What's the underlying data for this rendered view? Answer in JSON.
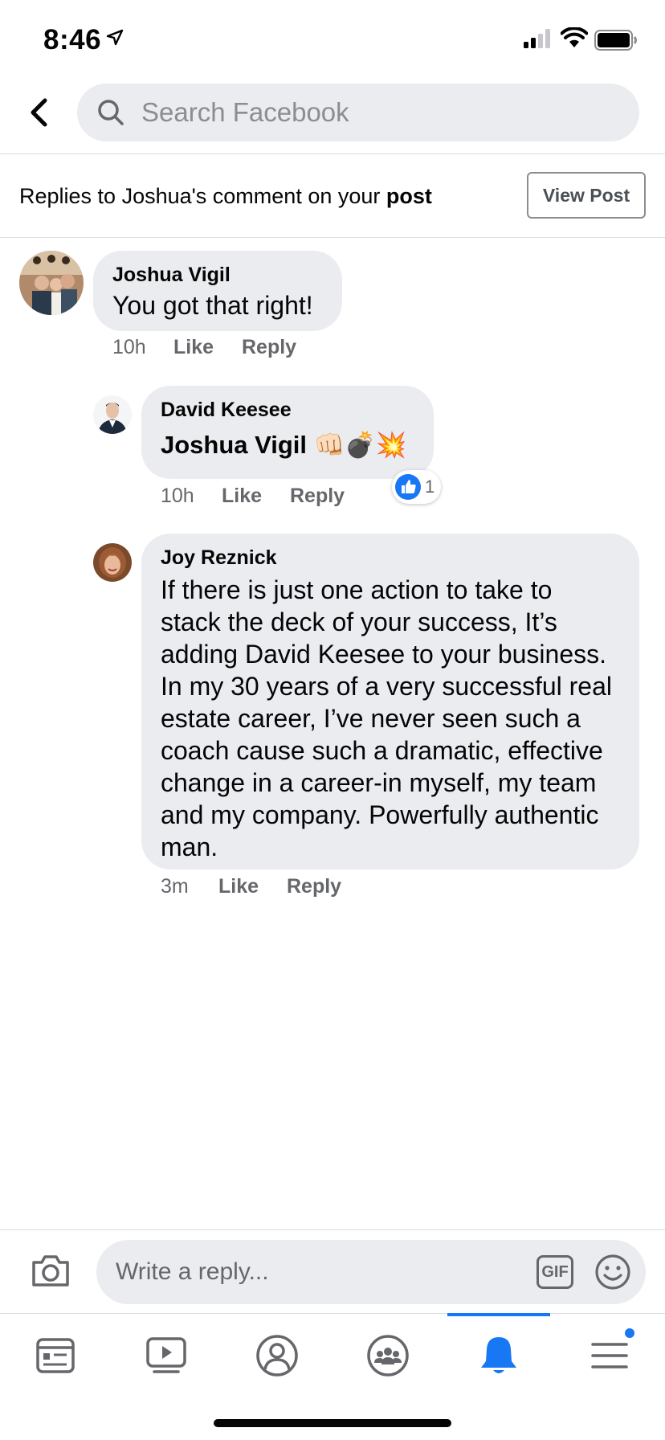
{
  "status_bar": {
    "time": "8:46"
  },
  "header": {
    "search_placeholder": "Search Facebook"
  },
  "banner": {
    "text_prefix": "Replies to Joshua's comment on your ",
    "text_bold": "post",
    "view_post_label": "View Post"
  },
  "comments": [
    {
      "author": "Joshua Vigil",
      "text": "You got that right!",
      "time": "10h",
      "like": "Like",
      "reply": "Reply"
    },
    {
      "author": "David Keesee",
      "text": "Joshua Vigil 👊🏻💣💥",
      "time": "10h",
      "like": "Like",
      "reply": "Reply",
      "reaction_count": "1"
    },
    {
      "author": "Joy Reznick",
      "text_lines": [
        "If there is just one action to take to",
        "stack the deck of your success, It’s",
        "adding David Keesee to your business.",
        "In my 30 years of a very successful real",
        "estate career, I’ve never seen such a",
        "coach cause such a dramatic, effective",
        "change in a career-in myself, my team",
        "and my company. Powerfully authentic",
        "man."
      ],
      "time": "3m",
      "like": "Like",
      "reply": "Reply"
    }
  ],
  "composer": {
    "placeholder": "Write a reply...",
    "gif_label": "GIF"
  },
  "tabs": [
    {
      "name": "news-feed",
      "icon": "news-feed-icon"
    },
    {
      "name": "watch",
      "icon": "video-icon"
    },
    {
      "name": "profile",
      "icon": "profile-icon"
    },
    {
      "name": "groups",
      "icon": "groups-icon"
    },
    {
      "name": "notifications",
      "icon": "bell-icon",
      "active": true
    },
    {
      "name": "menu",
      "icon": "menu-icon"
    }
  ],
  "colors": {
    "accent": "#1877f2",
    "bubble": "#eaecef",
    "muted": "#65676b"
  }
}
